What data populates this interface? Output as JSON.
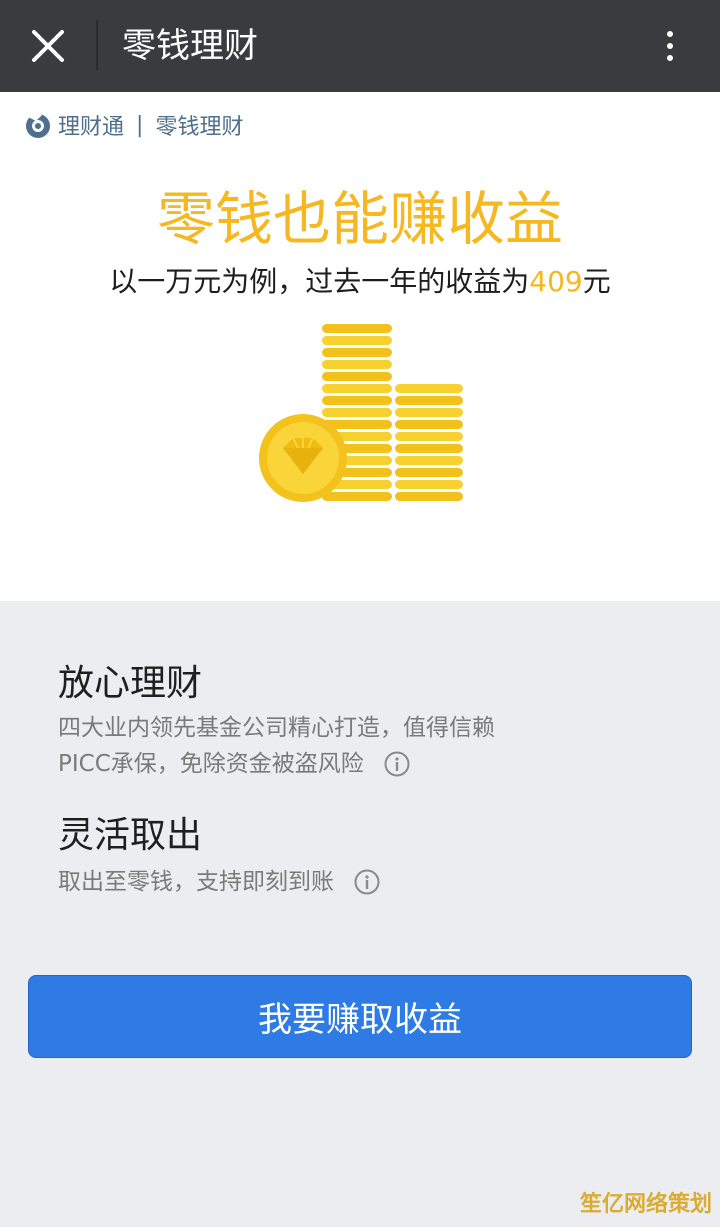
{
  "titlebar": {
    "title": "零钱理财",
    "close_icon": "close-icon",
    "more_icon": "more-vertical-icon"
  },
  "brand": {
    "name": "理财通",
    "separator": "|",
    "section": "零钱理财"
  },
  "hero": {
    "headline": "零钱也能赚收益",
    "sub_prefix": "以一万元为例，过去一年的收益为",
    "sub_amount": "409",
    "sub_suffix": "元"
  },
  "features": [
    {
      "title": "放心理财",
      "lines": [
        "四大业内领先基金公司精心打造，值得信赖",
        "PICC承保，免除资金被盗风险"
      ]
    },
    {
      "title": "灵活取出",
      "lines": [
        "取出至零钱，支持即刻到账"
      ]
    }
  ],
  "cta": {
    "label": "我要赚取收益"
  },
  "watermark": "笙亿网络策划",
  "colors": {
    "titlebar_bg": "#3a3b3e",
    "accent_gold": "#f5b822",
    "button_blue": "#2f7be6",
    "page_bg": "#ebedf0"
  }
}
